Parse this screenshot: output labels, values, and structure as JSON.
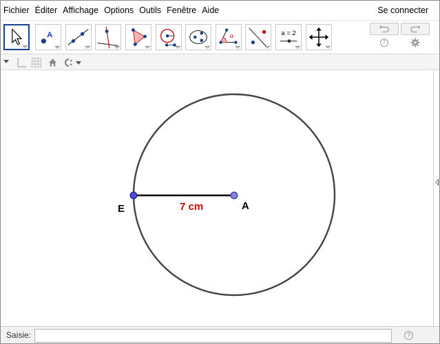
{
  "menu": {
    "items": [
      "Fichier",
      "Éditer",
      "Affichage",
      "Options",
      "Outils",
      "Fenêtre",
      "Aide"
    ],
    "login": "Se connecter"
  },
  "toolbar": {
    "tools": [
      {
        "name": "move-tool",
        "icon": "arrow-cursor-icon",
        "active": true
      },
      {
        "name": "point-tool",
        "icon": "point-icon",
        "label": "A"
      },
      {
        "name": "line-tool",
        "icon": "line-icon"
      },
      {
        "name": "perpendicular-tool",
        "icon": "perpendicular-line-icon"
      },
      {
        "name": "polygon-tool",
        "icon": "polygon-icon"
      },
      {
        "name": "circle-tool",
        "icon": "circle-center-point-icon"
      },
      {
        "name": "conic-tool",
        "icon": "ellipse-icon"
      },
      {
        "name": "angle-tool",
        "icon": "angle-icon",
        "label": "α"
      },
      {
        "name": "reflect-tool",
        "icon": "reflect-icon"
      },
      {
        "name": "slider-tool",
        "icon": "slider-icon",
        "label": "a = 2"
      },
      {
        "name": "move-graphics-tool",
        "icon": "move-graphics-icon"
      }
    ],
    "undo_icon": "undo-icon",
    "redo_icon": "redo-icon",
    "help": "?",
    "settings_icon": "gear-icon"
  },
  "stylebar": {
    "items": [
      "axes-toggle-icon",
      "grid-toggle-icon",
      "home-icon",
      "point-capture-icon"
    ]
  },
  "graphics": {
    "points": [
      {
        "name": "E",
        "color": "#4b4bd8"
      },
      {
        "name": "A",
        "color": "#7f7ff0"
      }
    ],
    "segment_label": "7 cm",
    "circle_color": "#444444",
    "label_color": "#cc0000"
  },
  "inputbar": {
    "label": "Saisie:",
    "value": "",
    "placeholder": "",
    "help": "?"
  }
}
